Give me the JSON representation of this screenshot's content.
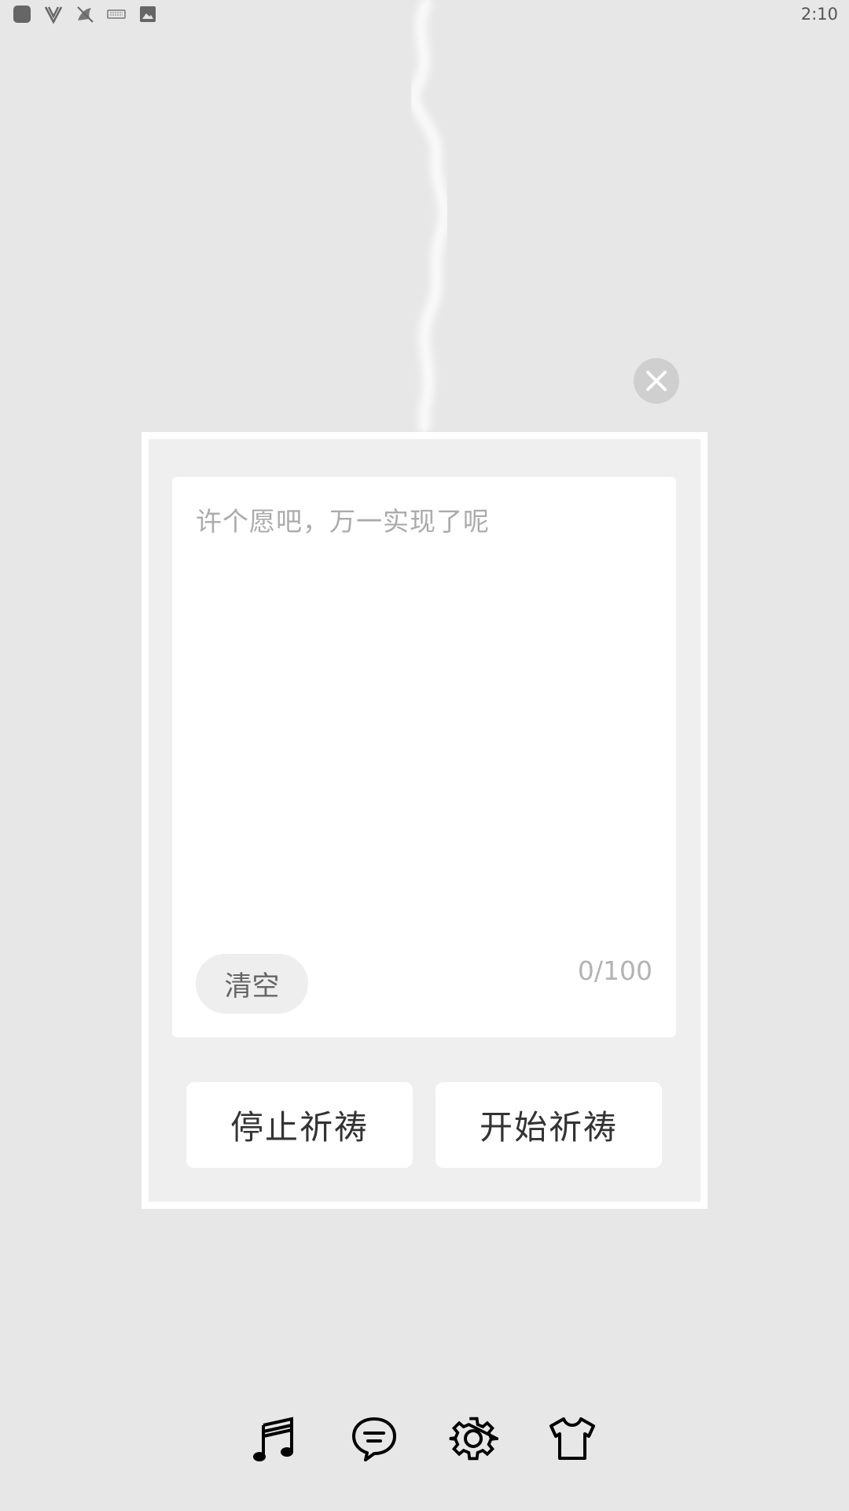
{
  "status_bar": {
    "time": "2:10",
    "icons": [
      "app-square-icon",
      "v-logo-icon",
      "bird-silent-icon",
      "keyboard-icon",
      "image-icon"
    ]
  },
  "close_icon": "close-icon",
  "wish": {
    "placeholder": "许个愿吧，万一实现了呢",
    "clear_label": "清空",
    "counter": "0/100"
  },
  "actions": {
    "stop_label": "停止祈祷",
    "start_label": "开始祈祷"
  },
  "bottom_nav": {
    "icons": [
      "music-icon",
      "chat-icon",
      "settings-icon",
      "shirt-icon"
    ]
  }
}
